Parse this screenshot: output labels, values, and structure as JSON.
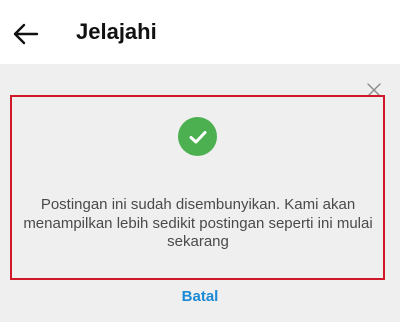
{
  "header": {
    "title": "Jelajahi",
    "back_icon": "arrow-left-icon"
  },
  "notice": {
    "icon": "checkmark-icon",
    "icon_color": "#4caf50",
    "highlight_color": "#d0182b",
    "message": "Postingan ini sudah disembunyikan. Kami akan menampilkan lebih sedikit postingan seperti ini mulai sekarang",
    "close_icon": "close-icon",
    "undo_label": "Batal",
    "undo_color": "#1a8ad6"
  }
}
